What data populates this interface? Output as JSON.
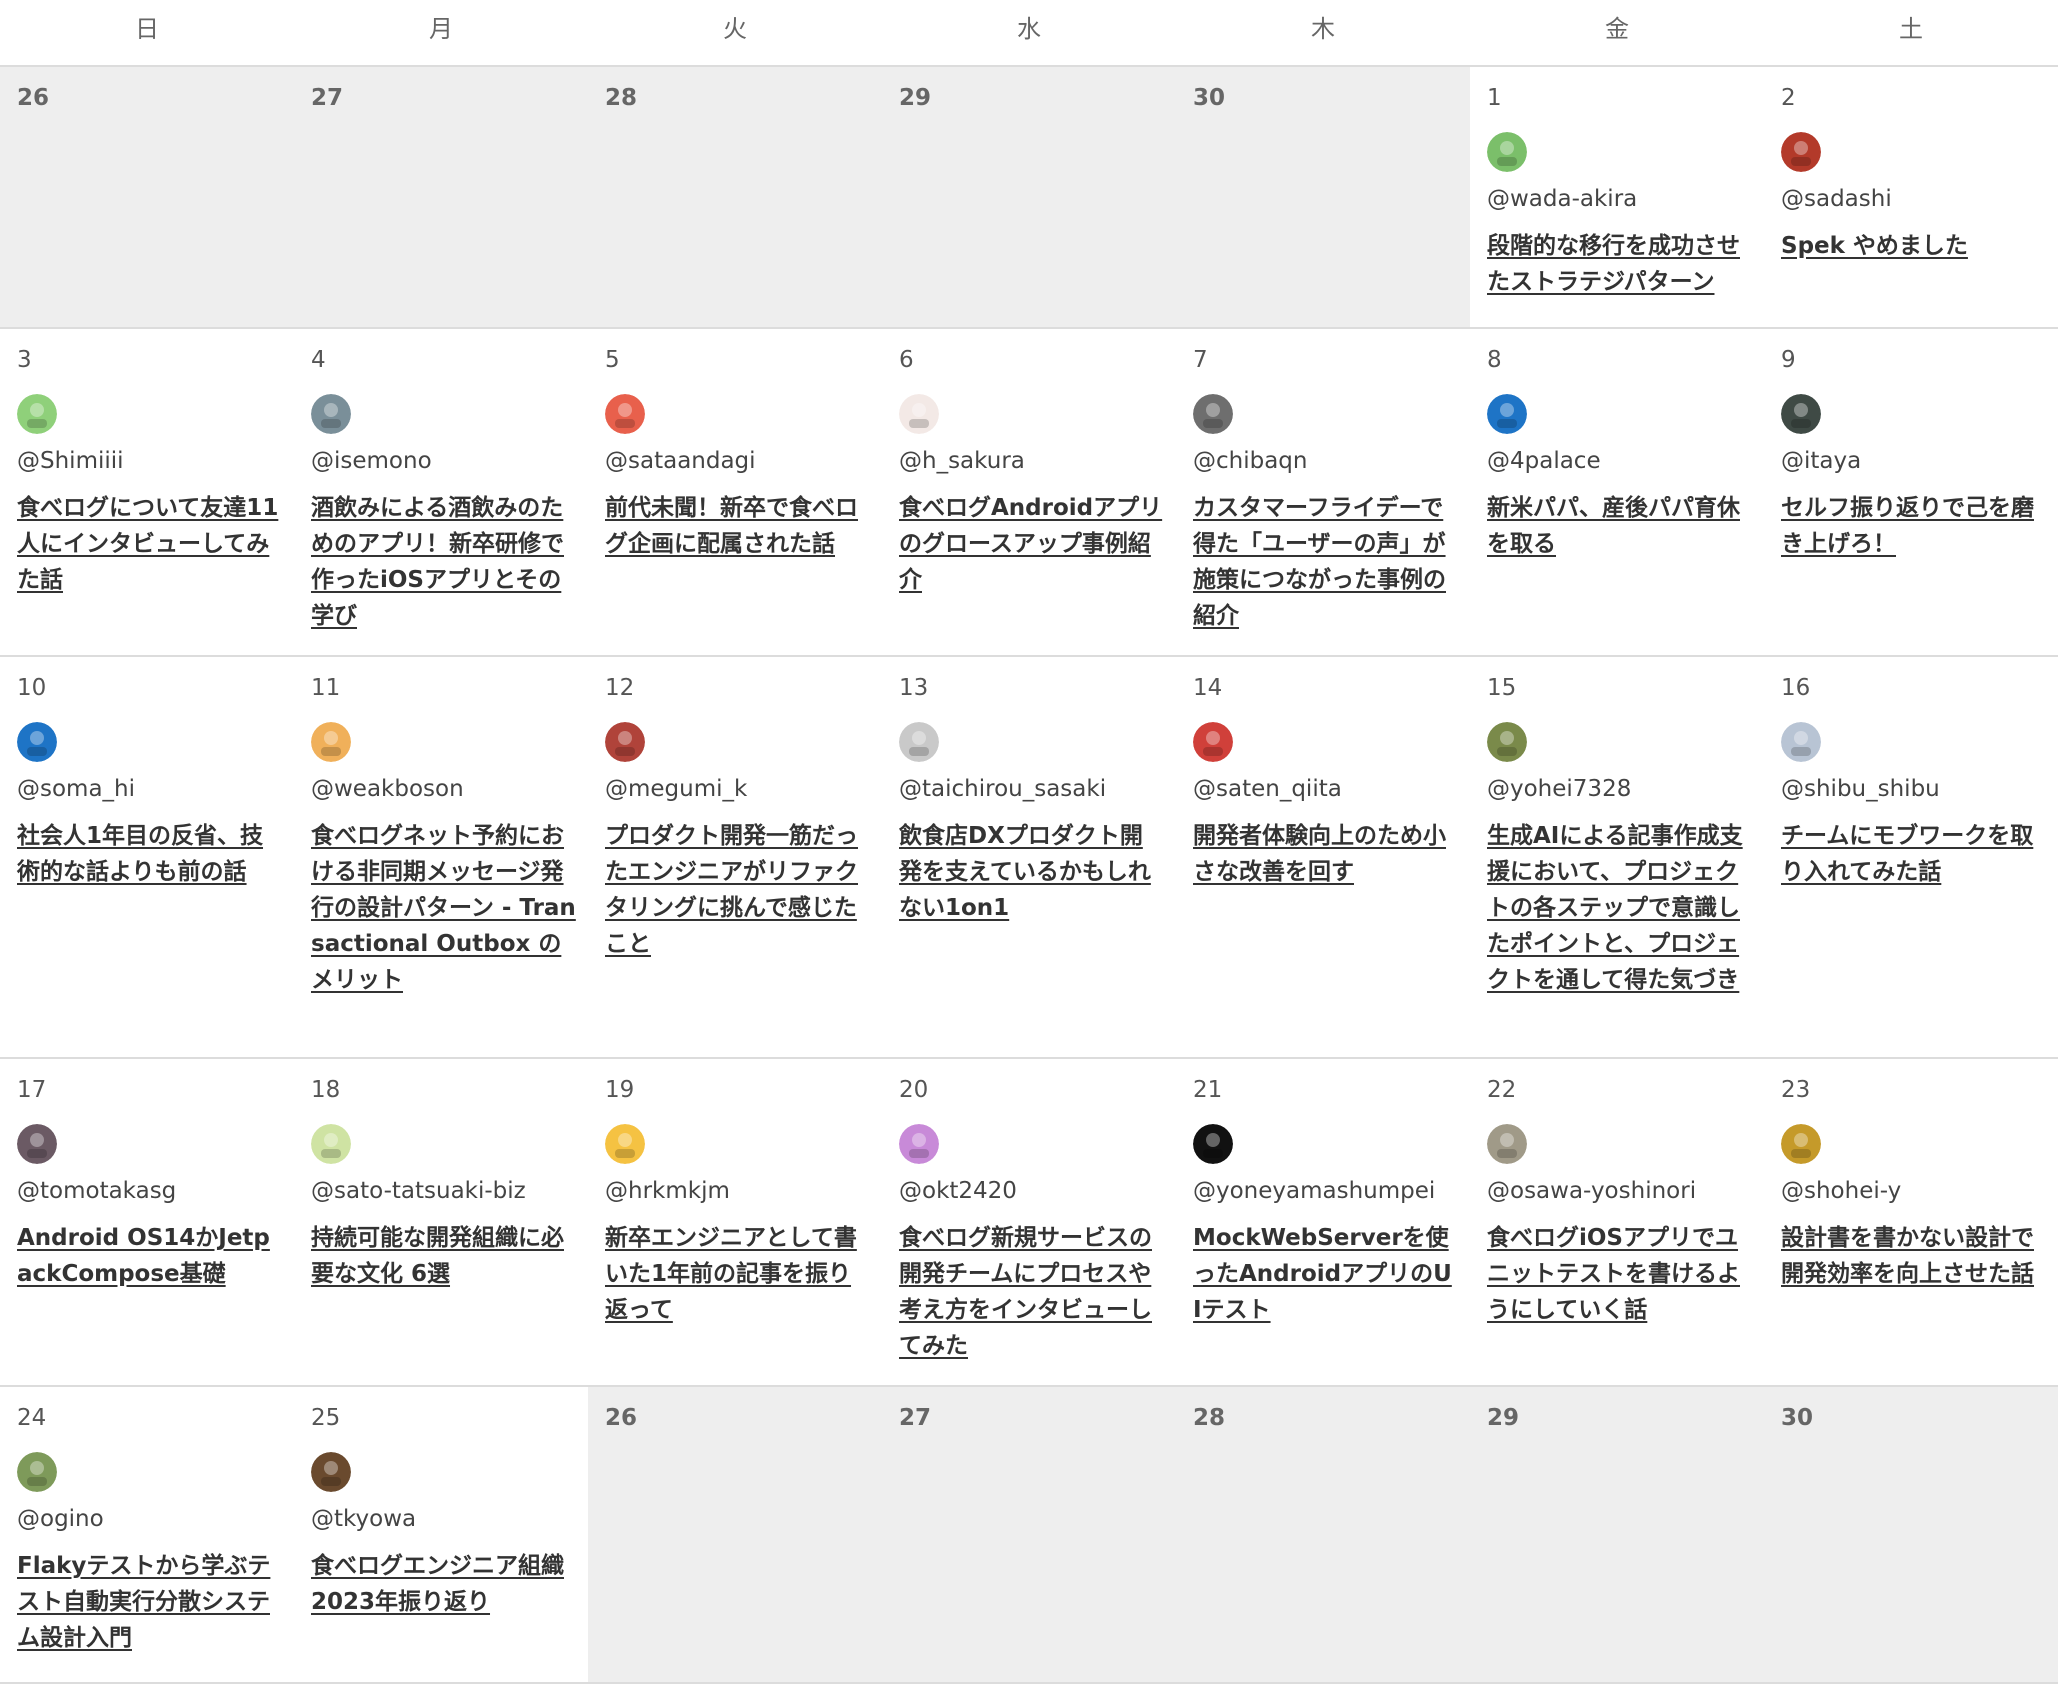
{
  "weekdays": [
    "日",
    "月",
    "火",
    "水",
    "木",
    "金",
    "土"
  ],
  "cells": [
    {
      "day": "26",
      "out": true
    },
    {
      "day": "27",
      "out": true
    },
    {
      "day": "28",
      "out": true
    },
    {
      "day": "29",
      "out": true
    },
    {
      "day": "30",
      "out": true
    },
    {
      "day": "1",
      "user": "@wada-akira",
      "title": "段階的な移行を成功させたストラテジパターン",
      "avatar_color": "#7bbf6a",
      "avatar_icon": "leaf-character-icon"
    },
    {
      "day": "2",
      "user": "@sadashi",
      "title": "Spek やめました",
      "avatar_color": "#b33a2a",
      "avatar_icon": "pixel-figure-icon"
    },
    {
      "day": "3",
      "user": "@Shimiiii",
      "title": "食べログについて友達11人にインタビューしてみた話",
      "avatar_color": "#8fd07a",
      "avatar_icon": "pixel-face-icon"
    },
    {
      "day": "4",
      "user": "@isemono",
      "title": "酒飲みによる酒飲みのためのアプリ！新卒研修で作ったiOSアプリとその学び",
      "avatar_color": "#7a8f99",
      "avatar_icon": "landscape-photo-icon"
    },
    {
      "day": "5",
      "user": "@sataandagi",
      "title": "前代未聞！新卒で食べログ企画に配属された話",
      "avatar_color": "#e8604c",
      "avatar_icon": "cartoon-face-icon"
    },
    {
      "day": "6",
      "user": "@h_sakura",
      "title": "食べログAndroidアプリのグロースアップ事例紹介",
      "avatar_color": "#f3e9e6",
      "avatar_icon": "emblem-icon"
    },
    {
      "day": "7",
      "user": "@chibaqn",
      "title": "カスタマーフライデーで得た「ユーザーの声」が施策につながった事例の紹介",
      "avatar_color": "#6e6e6e",
      "avatar_icon": "photo-icon"
    },
    {
      "day": "8",
      "user": "@4palace",
      "title": "新米パパ、産後パパ育休を取る",
      "avatar_color": "#1e74c6",
      "avatar_icon": "power-icon"
    },
    {
      "day": "9",
      "user": "@itaya",
      "title": "セルフ振り返りで己を磨き上げろ！",
      "avatar_color": "#3f4a45",
      "avatar_icon": "photo-icon"
    },
    {
      "day": "10",
      "user": "@soma_hi",
      "title": "社会人1年目の反省、技術的な話よりも前の話",
      "avatar_color": "#1e74c6",
      "avatar_icon": "power-icon"
    },
    {
      "day": "11",
      "user": "@weakboson",
      "title": "食べログネット予約における非同期メッセージ発行の設計パターン - Transactional Outbox のメリット",
      "avatar_color": "#f0b05a",
      "avatar_icon": "cat-face-icon"
    },
    {
      "day": "12",
      "user": "@megumi_k",
      "title": "プロダクト開発一筋だったエンジニアがリファクタリングに挑んで感じたこと",
      "avatar_color": "#b0433a",
      "avatar_icon": "food-photo-icon"
    },
    {
      "day": "13",
      "user": "@taichirou_sasaki",
      "title": "飲食店DXプロダクト開発を支えているかもしれない1on1",
      "avatar_color": "#c9c9c9",
      "avatar_icon": "face-sketch-icon"
    },
    {
      "day": "14",
      "user": "@saten_qiita",
      "title": "開発者体験向上のため小さな改善を回す",
      "avatar_color": "#d0403a",
      "avatar_icon": "photo-icon"
    },
    {
      "day": "15",
      "user": "@yohei7328",
      "title": "生成AIによる記事作成支援において、プロジェクトの各ステップで意識したポイントと、プロジェクトを通して得た気づき",
      "avatar_color": "#7a8a4a",
      "avatar_icon": "landscape-photo-icon"
    },
    {
      "day": "16",
      "user": "@shibu_shibu",
      "title": "チームにモブワークを取り入れてみた話",
      "avatar_color": "#b8c4d4",
      "avatar_icon": "sketch-icon"
    },
    {
      "day": "17",
      "user": "@tomotakasg",
      "title": "Android OS14かJetpackCompose基礎",
      "avatar_color": "#6b5a64",
      "avatar_icon": "landscape-photo-icon"
    },
    {
      "day": "18",
      "user": "@sato-tatsuaki-biz",
      "title": "持続可能な開発組織に必要な文化 6選",
      "avatar_color": "#cfe3a3",
      "avatar_icon": "pixel-face-icon"
    },
    {
      "day": "19",
      "user": "@hrkmkjm",
      "title": "新卒エンジニアとして書いた1年前の記事を振り返って",
      "avatar_color": "#f5c242",
      "avatar_icon": "circle-icon"
    },
    {
      "day": "20",
      "user": "@okt2420",
      "title": "食べログ新規サービスの開発チームにプロセスや考え方をインタビューしてみた",
      "avatar_color": "#c88ad8",
      "avatar_icon": "pixel-pattern-icon"
    },
    {
      "day": "21",
      "user": "@yoneyamashumpei",
      "title": "MockWebServerを使ったAndroidアプリのUIテスト",
      "avatar_color": "#111111",
      "avatar_icon": "moon-icon"
    },
    {
      "day": "22",
      "user": "@osawa-yoshinori",
      "title": "食べログiOSアプリでユニットテストを書けるようにしていく話",
      "avatar_color": "#a09a88",
      "avatar_icon": "animal-photo-icon"
    },
    {
      "day": "23",
      "user": "@shohei-y",
      "title": "設計書を書かない設計で開発効率を向上させた話",
      "avatar_color": "#c59a2a",
      "avatar_icon": "mask-icon"
    },
    {
      "day": "24",
      "user": "@ogino",
      "title": "Flakyテストから学ぶテスト自動実行分散システム設計入門",
      "avatar_color": "#7e9a5a",
      "avatar_icon": "character-icon"
    },
    {
      "day": "25",
      "user": "@tkyowa",
      "title": "食べログエンジニア組織2023年振り返り",
      "avatar_color": "#6a4a2e",
      "avatar_icon": "photo-icon"
    },
    {
      "day": "26",
      "out": true
    },
    {
      "day": "27",
      "out": true
    },
    {
      "day": "28",
      "out": true
    },
    {
      "day": "29",
      "out": true
    },
    {
      "day": "30",
      "out": true
    }
  ]
}
